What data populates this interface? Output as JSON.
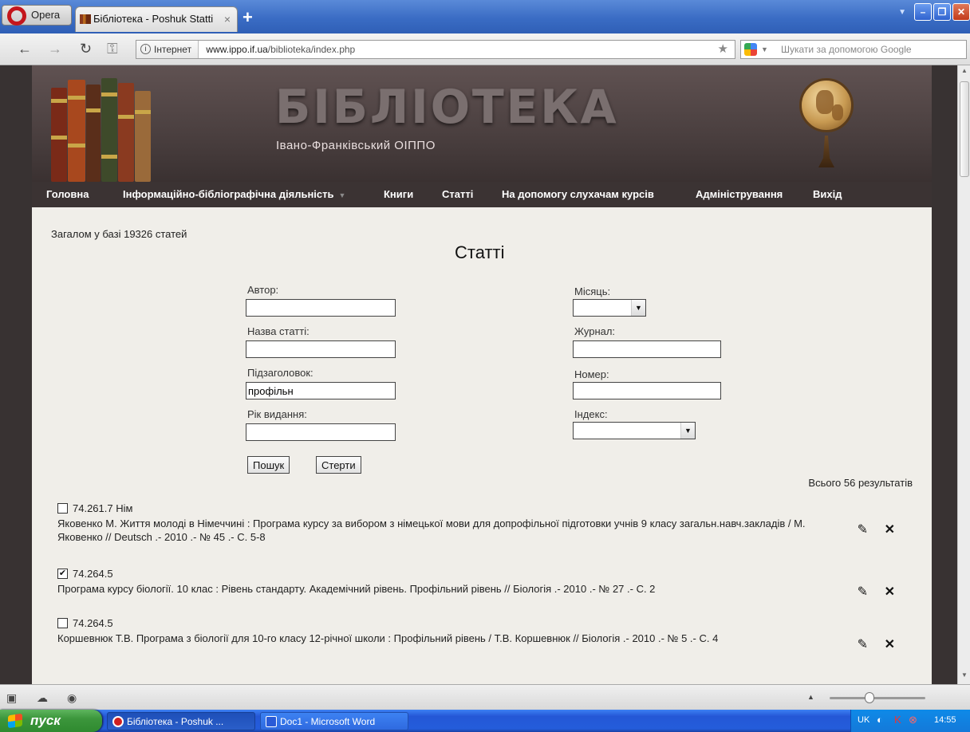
{
  "browser": {
    "opera_label": "Opera",
    "tab_title": "Бібліотека - Poshuk Statti",
    "tab_close": "×",
    "new_tab": "+",
    "zone": "Інтернет",
    "url_domain": "www.ippo.if.ua",
    "url_path": "/biblioteka/index.php",
    "search_placeholder": "Шукати за допомогою Google"
  },
  "site": {
    "title": "БІБЛІОТЕКА",
    "subtitle": "Івано-Франківський ОІППО",
    "menu": [
      {
        "label": "Головна"
      },
      {
        "label": "Інформаційно-бібліографічна діяльність"
      },
      {
        "label": "Книги"
      },
      {
        "label": "Статті"
      },
      {
        "label": "На допомогу слухачам курсів"
      },
      {
        "label": "Адміністрування"
      },
      {
        "label": "Вихід"
      }
    ]
  },
  "page": {
    "total_text": "Загалом у базі 19326 статей",
    "heading": "Статті",
    "results_count": "Всього 56 результатів"
  },
  "form": {
    "author_label": "Автор:",
    "author_value": "",
    "title_label": "Назва статті:",
    "title_value": "",
    "subtitle_label": "Підзаголовок:",
    "subtitle_value": "профільн",
    "year_label": "Рік видання:",
    "year_value": "",
    "month_label": "Місяць:",
    "month_value": "",
    "journal_label": "Журнал:",
    "journal_value": "",
    "number_label": "Номер:",
    "number_value": "",
    "index_label": "Індекс:",
    "index_value": "",
    "search_button": "Пошук",
    "clear_button": "Стерти"
  },
  "results": [
    {
      "index": "74.261.7 Нім",
      "checked": false,
      "text": "Яковенко М. Життя молоді в Німеччині : Програма курсу за вибором з німецької мови для допрофільної підготовки учнів 9 класу загальн.навч.закладів / М. Яковенко // Deutsch .- 2010 .- № 45 .- С. 5-8"
    },
    {
      "index": "74.264.5",
      "checked": true,
      "text": "Програма курсу біології. 10 клас : Рівень стандарту. Академічний рівень. Профільний рівень // Біологія .- 2010 .- № 27 .- С. 2"
    },
    {
      "index": "74.264.5",
      "checked": false,
      "text": "Коршевнюк Т.В. Програма з біології для 10-го класу 12-річної школи : Профільний рівень / Т.В. Коршевнюк // Біологія .- 2010 .- № 5 .- С. 4"
    }
  ],
  "taskbar": {
    "start_label": "пуск",
    "tasks": [
      {
        "label": "Бібліотека - Poshuk ..."
      },
      {
        "label": "Doc1 - Microsoft Word"
      }
    ],
    "lang": "UK",
    "time": "14:55"
  },
  "icons": {
    "edit": "pencil-icon",
    "delete": "cross-icon"
  }
}
